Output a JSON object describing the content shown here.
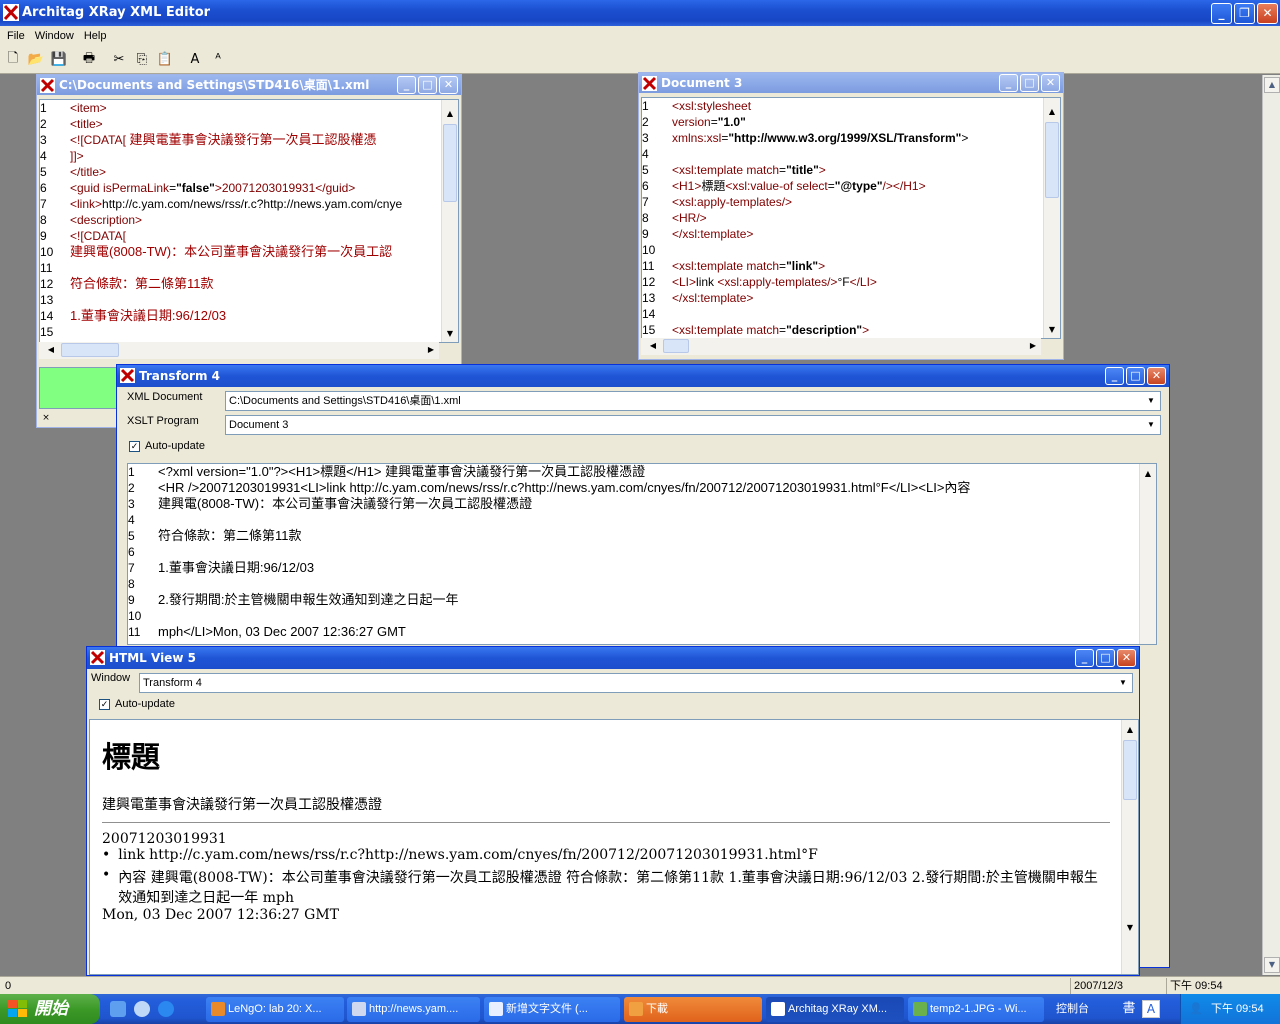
{
  "app": {
    "title": "Architag XRay XML Editor",
    "menu": [
      "File",
      "Window",
      "Help"
    ],
    "caps": {
      "min": "_",
      "restore": "❐",
      "close": "✕"
    }
  },
  "toolbar": {
    "new": "🗋",
    "open": "📂",
    "save": "💾",
    "print": "🖶",
    "cut": "✂",
    "copy": "⎘",
    "paste": "📋",
    "font_up": "A",
    "font_down": "ᴬ"
  },
  "windows": {
    "xml_doc": {
      "title": "C:\\Documents and Settings\\STD416\\桌面\\1.xml",
      "gutter": [
        "1",
        "2",
        "3",
        "4",
        "5",
        "6",
        "7",
        "8",
        "9",
        "10",
        "11",
        "12",
        "13",
        "14",
        "15"
      ]
    },
    "document3": {
      "title": "Document 3",
      "gutter": [
        "1",
        "2",
        "3",
        "4",
        "5",
        "6",
        "7",
        "8",
        "9",
        "10",
        "11",
        "12",
        "13",
        "14",
        "15"
      ]
    },
    "transform4": {
      "title": "Transform 4",
      "xml_label": "XML Document",
      "xml_value": "C:\\Documents and Settings\\STD416\\桌面\\1.xml",
      "xslt_label": "XSLT Program",
      "xslt_value": "Document 3",
      "auto_update": "Auto-update",
      "gutter": [
        "1",
        "2",
        "3",
        "4",
        "5",
        "6",
        "7",
        "8",
        "9",
        "10",
        "11"
      ],
      "lines": [
        "<?xml version=\"1.0\"?><H1>標題</H1>  建興電董事會決議發行第一次員工認股權憑證",
        "  <HR />20071203019931<LI>link http://c.yam.com/news/rss/r.c?http://news.yam.com/cnyes/fn/200712/20071203019931.html°F</LI><LI>內容",
        " 建興電(8008-TW)：本公司董事會決議發行第一次員工認股權憑證",
        "",
        "符合條款：第二條第11款",
        "",
        "1.董事會決議日期:96/12/03",
        "",
        "2.發行期間:於主管機關申報生效通知到達之日起一年",
        "",
        "  mph</LI>Mon, 03 Dec 2007 12:36:27 GMT"
      ]
    },
    "htmlview5": {
      "title": "HTML View 5",
      "window_label": "Window",
      "window_value": "Transform 4",
      "auto_update": "Auto-update",
      "h1": "標題",
      "subtitle": "建興電董事會決議發行第一次員工認股權憑證",
      "id_line": "20071203019931",
      "bullet1": "link http://c.yam.com/news/rss/r.c?http://news.yam.com/cnyes/fn/200712/20071203019931.html°F",
      "bullet2": "內容 建興電(8008-TW)：本公司董事會決議發行第一次員工認股權憑證 符合條款：第二條第11款 1.董事會決議日期:96/12/03 2.發行期間:於主管機關申報生效通知到達之日起一年 mph",
      "date_line": "Mon, 03 Dec 2007 12:36:27 GMT"
    }
  },
  "xml_code": {
    "l1": "<item>",
    "l2": " <title>",
    "l3a": " <![CDATA[",
    "l3b": "  建興電董事會決議發行第一次員工認股權憑",
    "l4": "  ]]>",
    "l5": "  </title>",
    "l6a": "  <guid ",
    "l6b": "isPermaLink",
    "l6c": "=",
    "l6d": "\"false\"",
    "l6e": ">20071203019931</guid>",
    "l7a": "  <link>",
    "l7b": "http://c.yam.com/news/rss/r.c?http://news.yam.com/cnye",
    "l8": "<description>",
    "l9": "<![CDATA[",
    "l10": " 建興電(8008-TW)：本公司董事會決議發行第一次員工認",
    "l12": "符合條款：第二條第11款",
    "l14": "1.董事會決議日期:96/12/03"
  },
  "xsl_code": {
    "l1": "<xsl:stylesheet",
    "l2a": "version",
    "l2b": "=",
    "l2c": "\"1.0\"",
    "l3a": "xmlns:xsl",
    "l3b": "=",
    "l3c": "\"http://www.w3.org/1999/XSL/Transform\"",
    "l3d": ">",
    "l5a": "<xsl:template match",
    "l5b": "=",
    "l5c": "\"title\"",
    "l5d": ">",
    "l6a": "<H1>",
    "l6b": "標題",
    "l6c": "<xsl:value-of select",
    "l6d": "=",
    "l6e": "\"@type\"",
    "l6f": "/></H1>",
    "l7": "<xsl:apply-templates/>",
    "l8": "<HR/>",
    "l9": "</xsl:template>",
    "l11a": "<xsl:template match",
    "l11b": "=",
    "l11c": "\"link\"",
    "l11d": ">",
    "l12a": "<LI>",
    "l12b": "link ",
    "l12c": "<xsl:apply-templates/>",
    "l12d": "°F",
    "l12e": "</LI>",
    "l13": "</xsl:template>",
    "l15a": "<xsl:template match",
    "l15b": "=",
    "l15c": "\"description\"",
    "l15d": ">"
  },
  "status": {
    "left": "0",
    "date": "2007/12/3",
    "time": "下午 09:54"
  },
  "taskbar": {
    "start": "開始",
    "tasks": [
      "LeNgO: lab 20: X...",
      "http://news.yam....",
      "新增文字文件 (...",
      "下載",
      "Architag XRay XM...",
      "temp2-1.JPG - Wi..."
    ],
    "control_panel": "控制台",
    "ime": "書",
    "clock": "下午 09:54"
  },
  "colors": {
    "titlebar": "#1f55d6",
    "tag": "#800000",
    "cdata": "#a00000",
    "green_panel": "#80ff80"
  }
}
